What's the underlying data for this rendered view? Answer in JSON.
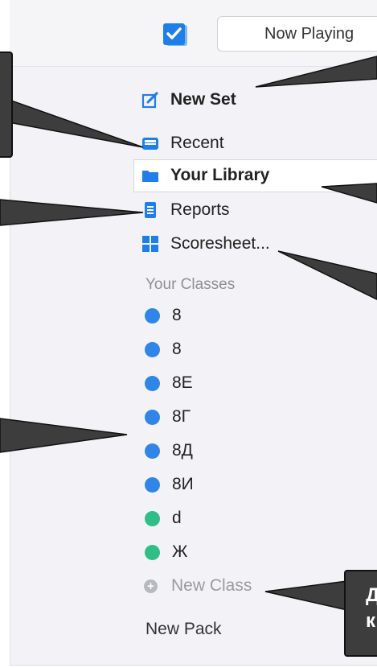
{
  "header": {
    "now_playing_label": "Now Playing"
  },
  "nav": {
    "new_set": "New Set",
    "recent": "Recent",
    "your_library": "Your Library",
    "reports": "Reports",
    "scoresheet": "Scoresheet..."
  },
  "classes": {
    "section_label": "Your Classes",
    "items": [
      {
        "name": "8",
        "color": "#2f86e6"
      },
      {
        "name": "8",
        "color": "#2f86e6"
      },
      {
        "name": "8E",
        "color": "#2f86e6"
      },
      {
        "name": "8Г",
        "color": "#2f86e6"
      },
      {
        "name": "8Д",
        "color": "#2f86e6"
      },
      {
        "name": "8И",
        "color": "#2f86e6"
      },
      {
        "name": "d",
        "color": "#2fbf86"
      },
      {
        "name": "Ж",
        "color": "#2fbf86"
      }
    ],
    "new_class_label": "New Class"
  },
  "new_pack_label": "New Pack",
  "callout": {
    "text_line1": "Д",
    "text_line2": "к"
  },
  "colors": {
    "accent_blue": "#1f7ee8",
    "panel_bg": "#f3f3f7",
    "callout_bg": "#3d3d3d"
  }
}
